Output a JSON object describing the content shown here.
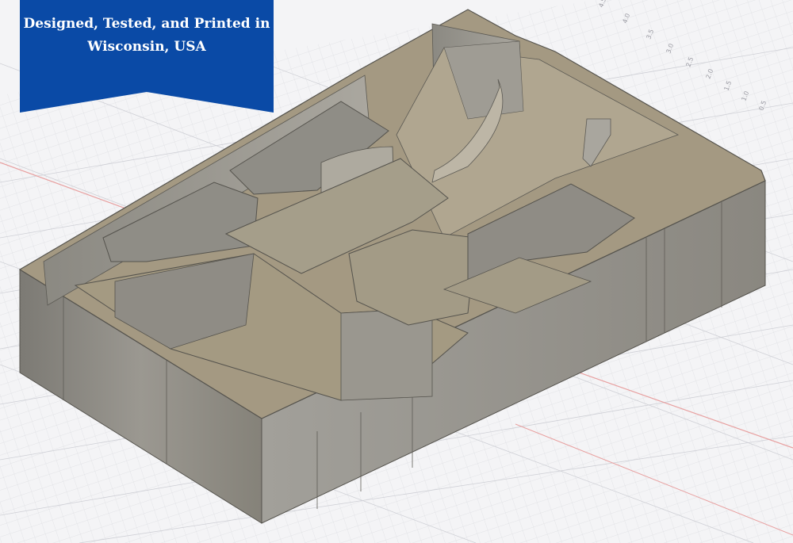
{
  "banner": {
    "line1": "Designed, Tested, and Printed in",
    "line2": "Wisconsin, USA",
    "color": "#0a4aa6"
  },
  "ruler": {
    "ticks": [
      "4.5",
      "4.0",
      "3.5",
      "3.0",
      "2.5",
      "2.0",
      "1.5",
      "1.0",
      "0.5"
    ]
  },
  "model": {
    "top_color": "#a49982",
    "wall_color": "#8e8b84",
    "grid_axis_red": "#e8a0a0",
    "grid_axis_blue": "#a8b4e8"
  }
}
